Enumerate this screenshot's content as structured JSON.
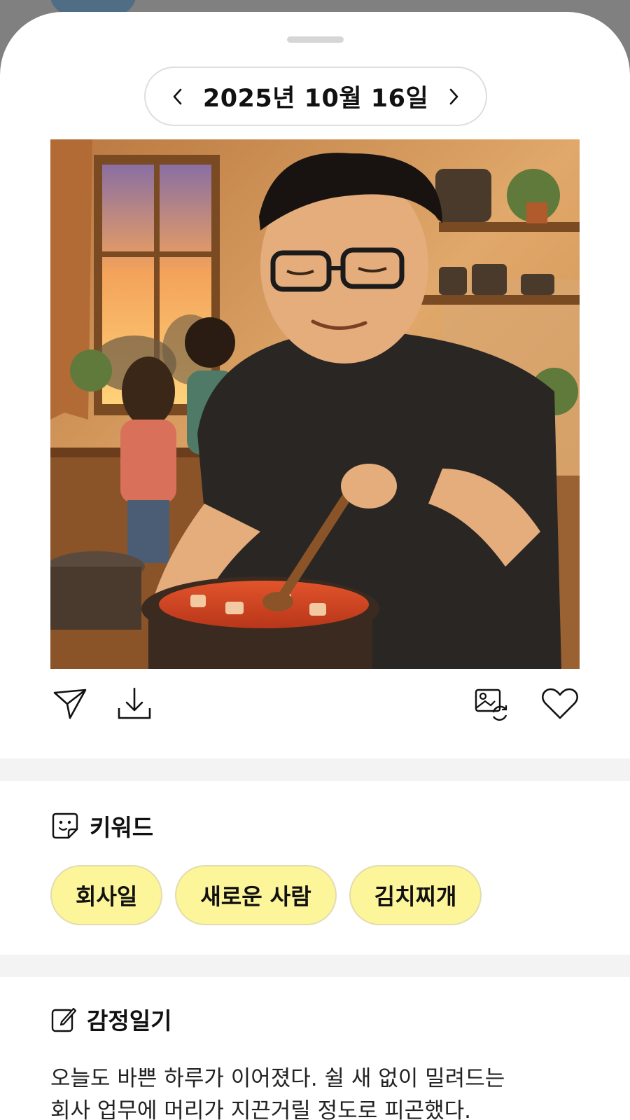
{
  "date_nav": {
    "prev_icon": "chevron-left-icon",
    "date_label": "2025년 10월 16일",
    "next_icon": "chevron-right-icon"
  },
  "image": {
    "description_icon": "illustration-image"
  },
  "actions": {
    "share_icon": "paper-plane-icon",
    "download_icon": "download-icon",
    "regenerate_icon": "image-refresh-icon",
    "like_icon": "heart-icon"
  },
  "keywords": {
    "title": "키워드",
    "icon": "sticker-smile-icon",
    "items": [
      "회사일",
      "새로운 사람",
      "김치찌개"
    ]
  },
  "diary": {
    "title": "감정일기",
    "icon": "edit-note-icon",
    "lines": [
      "오늘도 바쁜 하루가 이어졌다. 쉴 새 없이 밀려드는",
      "회사 업무에 머리가 지끈거릴 정도로 피곤했다."
    ]
  },
  "colors": {
    "chip_bg": "#fdf59a",
    "sheet_bg": "#ffffff",
    "backdrop": "#808080"
  }
}
